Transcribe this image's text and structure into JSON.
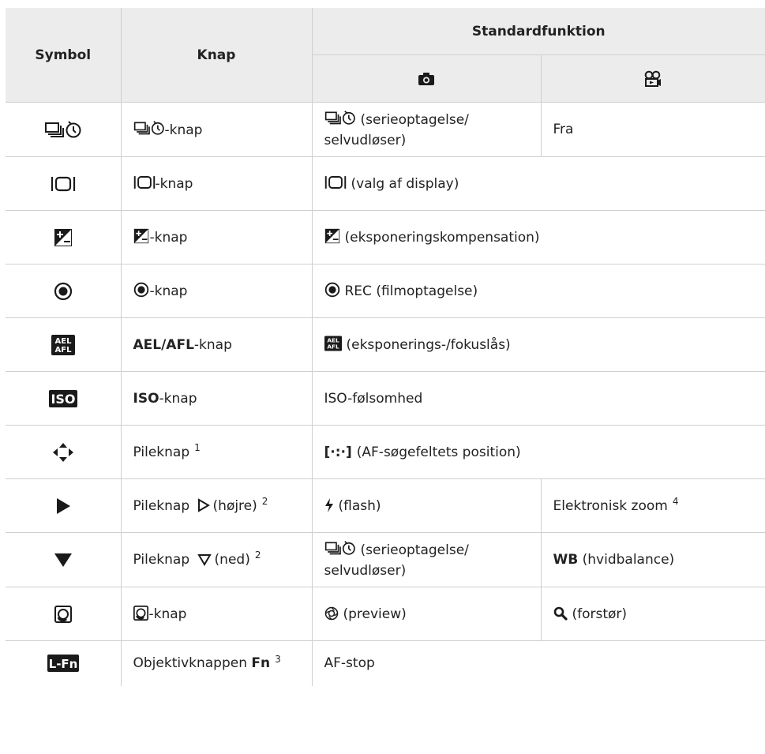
{
  "header": {
    "symbol": "Symbol",
    "knap": "Knap",
    "standardfunktion": "Standardfunktion"
  },
  "header_icons": [
    "camera-icon",
    "movie-camera-icon"
  ],
  "rows": {
    "r1": {
      "symbol_icon": "drive-selftimer-icon",
      "knap_suffix": "-knap",
      "photo_text": "(serieoptagelse/",
      "photo_text2": "selvudløser)",
      "movie_text": "Fra"
    },
    "r2": {
      "symbol_icon": "display-icon",
      "knap_suffix": "-knap",
      "func_text": "(valg af display)"
    },
    "r3": {
      "symbol_icon": "exposure-compensation-icon",
      "knap_suffix": "-knap",
      "func_text": "(eksponeringskompensation)"
    },
    "r4": {
      "symbol_icon": "rec-icon",
      "knap_suffix": "-knap",
      "func_text": "REC (filmoptagelse)"
    },
    "r5": {
      "symbol_icon": "ael-afl-icon",
      "knap_bold": "AEL/AFL",
      "knap_suffix": "-knap",
      "func_text": "(eksponerings-/fokuslås)",
      "icon_top": "AEL",
      "icon_bottom": "AFL"
    },
    "r6": {
      "symbol_icon": "iso-icon",
      "knap_bold": "ISO",
      "knap_suffix": "-knap",
      "func_text": "ISO-følsomhed",
      "icon_label": "ISO"
    },
    "r7": {
      "symbol_icon": "arrow-pad-icon",
      "knap_text": "Pileknap",
      "knap_sup": "1",
      "func_text": "(AF-søgefeltets position)",
      "func_icon_text": "[·:·]"
    },
    "r8": {
      "symbol_icon": "right-triangle-icon",
      "knap_text": "Pileknap",
      "knap_text2": "(højre)",
      "knap_sup": "2",
      "photo_text": "(flash)",
      "movie_text": "Elektronisk zoom",
      "movie_sup": "4"
    },
    "r9": {
      "symbol_icon": "down-triangle-icon",
      "knap_text": "Pileknap",
      "knap_text2": "(ned)",
      "knap_sup": "2",
      "photo_text": "(serieoptagelse/",
      "photo_text2": "selvudløser)",
      "movie_bold": "WB",
      "movie_text": "(hvidbalance)"
    },
    "r10": {
      "symbol_icon": "preview-button-icon",
      "knap_suffix": "-knap",
      "photo_text": "(preview)",
      "movie_text": "(forstør)"
    },
    "r11": {
      "symbol_icon": "l-fn-icon",
      "knap_text": "Objektivknappen",
      "knap_bold": "Fn",
      "knap_sup": "3",
      "func_text": "AF-stop",
      "icon_label": "L-Fn"
    }
  }
}
